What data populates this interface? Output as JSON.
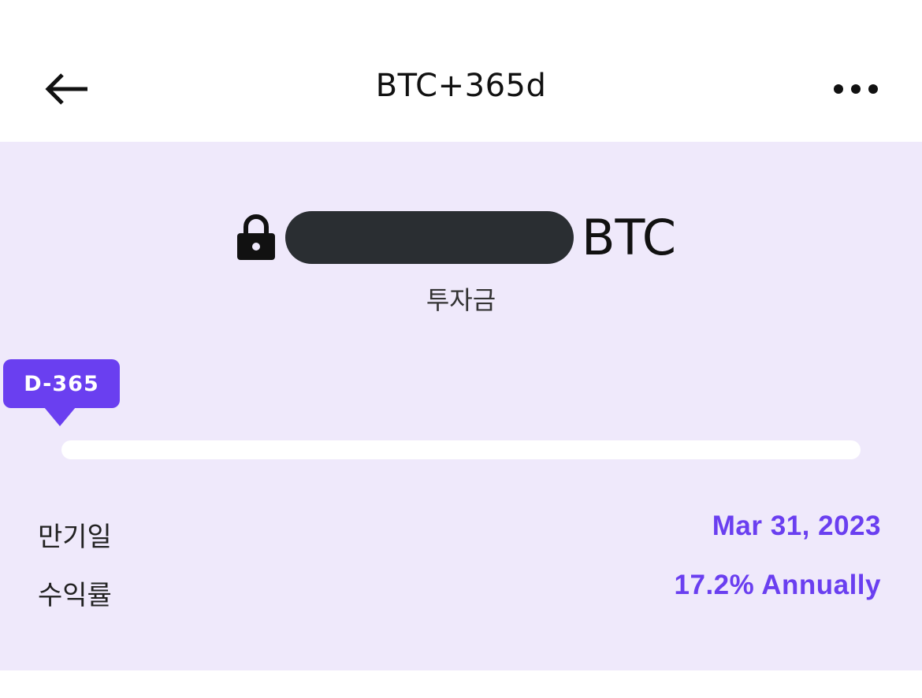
{
  "header": {
    "title": "BTC+365d",
    "back_icon": "arrow-left-icon",
    "more_icon": "more-horizontal-icon"
  },
  "summary": {
    "lock_icon": "lock-icon",
    "amount_redacted": true,
    "unit": "BTC",
    "amount_label": "투자금"
  },
  "progress": {
    "badge": "D-365",
    "elapsed_fraction": 0.0
  },
  "details": {
    "maturity_label": "만기일",
    "maturity_value": "Mar 31, 2023",
    "yield_label": "수익률",
    "yield_value": "17.2% Annually"
  },
  "colors": {
    "accent": "#6a3ff0",
    "card_background": "#efe9fb",
    "redaction": "#2a2e32"
  }
}
